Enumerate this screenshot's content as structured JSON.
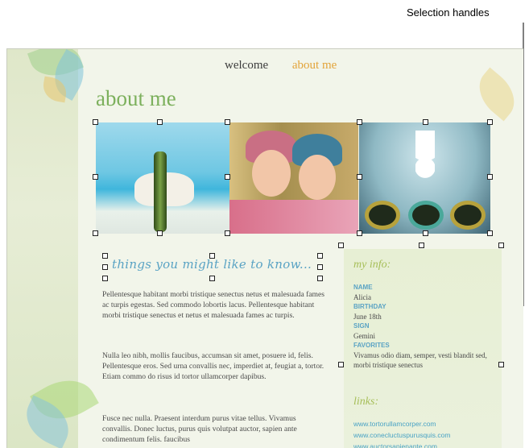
{
  "annotation": {
    "callout": "Selection handles"
  },
  "nav": {
    "items": [
      "welcome",
      "about me"
    ]
  },
  "page": {
    "title": "about me",
    "subheading": "things you might like to know..."
  },
  "photos": [
    {
      "label": "beach stones photo"
    },
    {
      "label": "two friends in knit hats photo"
    },
    {
      "label": "orchid and bowls photo"
    }
  ],
  "content": {
    "paragraphs": [
      "Pellentesque habitant morbi tristique senectus netus et malesuada fames ac turpis egestas. Sed commodo lobortis lacus. Pellentesque habitant morbi tristique senectus et netus et malesuada fames ac turpis.",
      "Nulla leo nibh, mollis faucibus, accumsan sit amet, posuere id, felis. Pellentesque eros. Sed urna convallis nec, imperdiet at, feugiat a, tortor. Etiam commo do risus id tortor ullamcorper dapibus.",
      "Fusce nec nulla. Praesent interdum purus vitae tellus. Vivamus convallis. Donec luctus, purus quis volutpat auctor, sapien ante condimentum felis. faucibus"
    ]
  },
  "sidebar": {
    "heading": "my info:",
    "fields": [
      {
        "label": "NAME",
        "value": "Alicia"
      },
      {
        "label": "BIRTHDAY",
        "value": "June 18th"
      },
      {
        "label": "SIGN",
        "value": "Gemini"
      },
      {
        "label": "FAVORITES",
        "value": "Vivamus odio diam, semper, vesti blandit sed, morbi tristique senectus"
      }
    ],
    "links_heading": "links:",
    "links": [
      "www.tortorullamcorper.com",
      "www.conecluctuspurusquis.com",
      "www.auctorsapienante.com"
    ]
  },
  "colors": {
    "accent_green": "#7cb05c",
    "accent_orange": "#e3a43a",
    "accent_blue": "#5aa3c4",
    "background": "#f2f5ea"
  }
}
